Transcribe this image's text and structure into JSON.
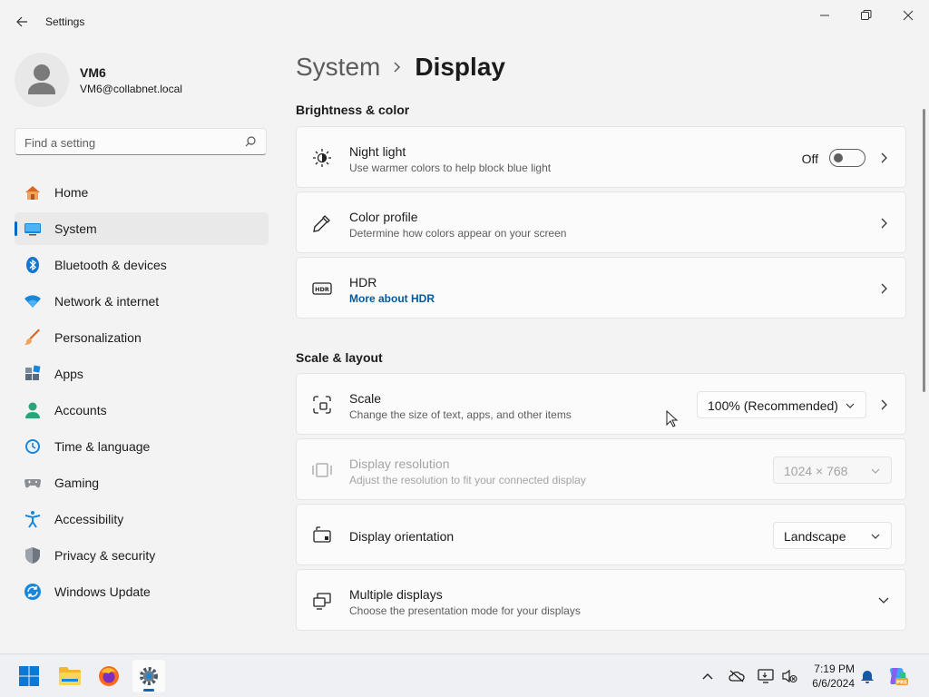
{
  "window": {
    "title": "Settings"
  },
  "profile": {
    "name": "VM6",
    "email": "VM6@collabnet.local"
  },
  "search": {
    "placeholder": "Find a setting"
  },
  "nav": {
    "items": [
      {
        "label": "Home",
        "icon": "home-icon"
      },
      {
        "label": "System",
        "icon": "system-icon",
        "active": true
      },
      {
        "label": "Bluetooth & devices",
        "icon": "bluetooth-icon"
      },
      {
        "label": "Network & internet",
        "icon": "network-icon"
      },
      {
        "label": "Personalization",
        "icon": "brush-icon"
      },
      {
        "label": "Apps",
        "icon": "apps-icon"
      },
      {
        "label": "Accounts",
        "icon": "accounts-icon"
      },
      {
        "label": "Time & language",
        "icon": "time-icon"
      },
      {
        "label": "Gaming",
        "icon": "gaming-icon"
      },
      {
        "label": "Accessibility",
        "icon": "accessibility-icon"
      },
      {
        "label": "Privacy & security",
        "icon": "shield-icon"
      },
      {
        "label": "Windows Update",
        "icon": "update-icon"
      }
    ]
  },
  "breadcrumb": {
    "parent": "System",
    "current": "Display"
  },
  "sections": {
    "brightness": "Brightness & color",
    "scale": "Scale & layout"
  },
  "cards": {
    "night_light": {
      "title": "Night light",
      "subtitle": "Use warmer colors to help block blue light",
      "state": "Off",
      "on": false
    },
    "color_profile": {
      "title": "Color profile",
      "subtitle": "Determine how colors appear on your screen"
    },
    "hdr": {
      "title": "HDR",
      "link": "More about HDR"
    },
    "scale": {
      "title": "Scale",
      "subtitle": "Change the size of text, apps, and other items",
      "value": "100% (Recommended)"
    },
    "resolution": {
      "title": "Display resolution",
      "subtitle": "Adjust the resolution to fit your connected display",
      "value": "1024 × 768",
      "disabled": true
    },
    "orientation": {
      "title": "Display orientation",
      "value": "Landscape"
    },
    "multiple": {
      "title": "Multiple displays",
      "subtitle": "Choose the presentation mode for your displays"
    }
  },
  "taskbar": {
    "time": "7:19 PM",
    "date": "6/6/2024"
  },
  "colors": {
    "accent": "#0067c0",
    "link": "#005a9e",
    "background": "#f3f3f3",
    "card": "#fbfbfb"
  }
}
